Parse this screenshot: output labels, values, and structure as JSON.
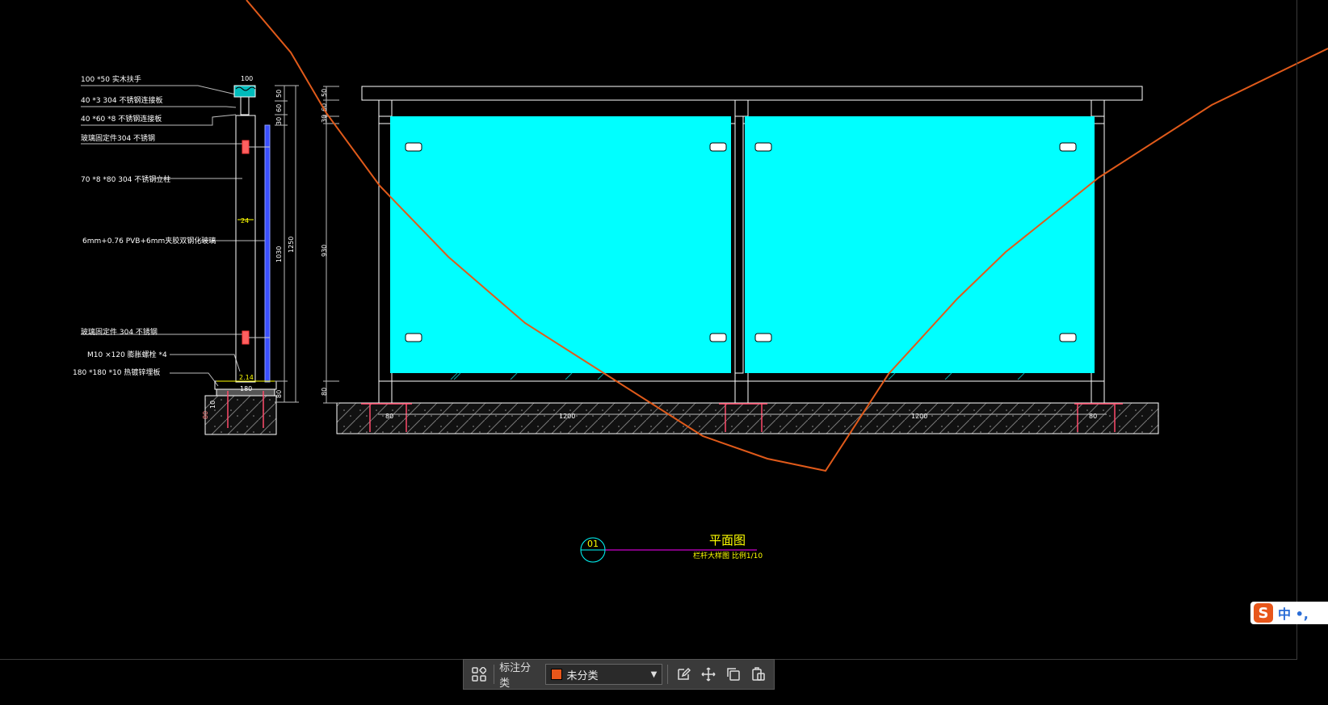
{
  "drawing": {
    "section_labels": [
      "100 *50 实木扶手",
      "40 *3  304 不锈钢连接板",
      "40 *60 *8 不锈钢连接板",
      "玻璃固定件304 不锈钢",
      "70 *8 *80  304 不锈钢立柱",
      "6mm+0.76 PVB+6mm夹胶双钢化玻璃",
      "玻璃固定件  304 不锈钢",
      "M10 ×120 膨胀螺栓 *4",
      "180 *180 *10 热镀锌埋板"
    ],
    "section_dims": {
      "top_width": "100",
      "d50": "50",
      "d60": "60",
      "d30": "30",
      "d1030": "1030",
      "d1250": "1250",
      "d80": "80",
      "w24": "24",
      "base": "180",
      "d214": "2.14",
      "d10": "10",
      "d80b": "80"
    },
    "elevation_dims": {
      "left_50": "50",
      "left_60": "60",
      "left_30": "30",
      "left_930": "930",
      "left_80": "80",
      "bottom_80a": "80",
      "bottom_1200a": "1200",
      "bottom_1200b": "1200",
      "bottom_80b": "80"
    },
    "title": {
      "number": "01",
      "main": "平面图",
      "sub": "栏杆大样图  比例1/10"
    }
  },
  "toolbar": {
    "label": "标注分类",
    "dropdown_value": "未分类",
    "dropdown_color": "#e8561a",
    "buttons": [
      "grid-icon",
      "edit-icon",
      "move-icon",
      "copy-icon",
      "paste-icon"
    ]
  },
  "ime": {
    "text": "中 •,"
  },
  "colors": {
    "glass": "#00ffff",
    "annotation_line": "#e05a1a",
    "dim_text": "#ffff00"
  }
}
